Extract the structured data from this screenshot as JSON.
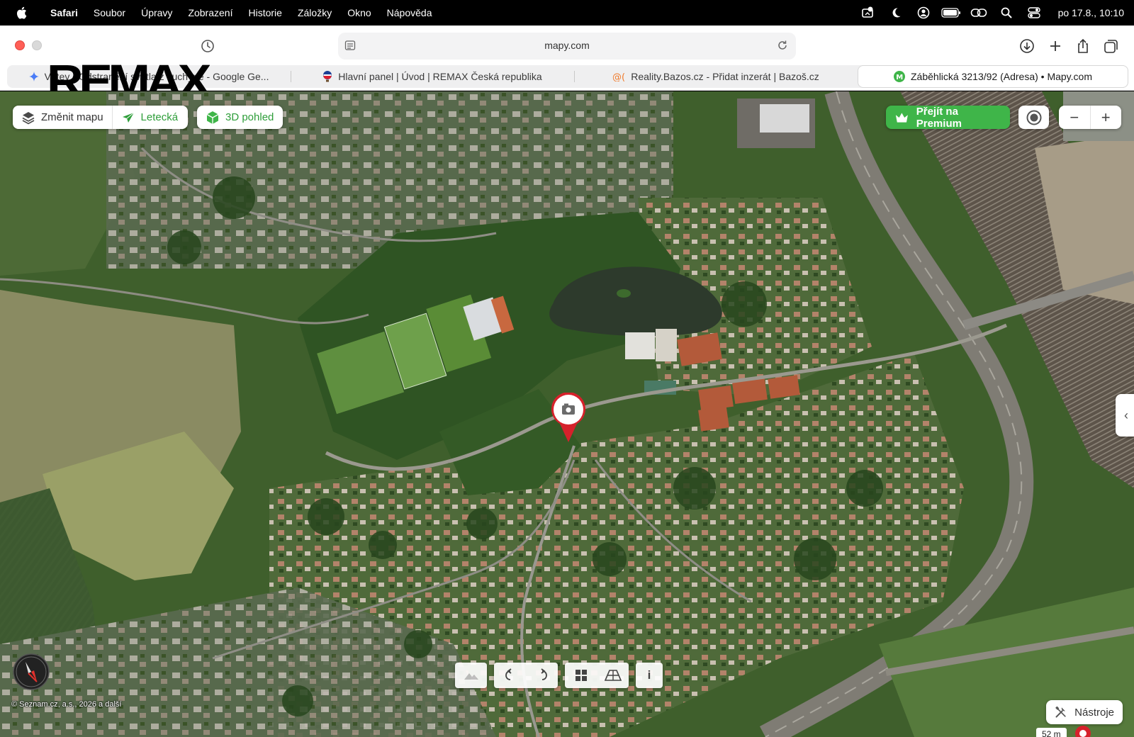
{
  "menubar": {
    "app": "Safari",
    "items": [
      "Soubor",
      "Úpravy",
      "Zobrazení",
      "Historie",
      "Záložky",
      "Okno",
      "Nápověda"
    ],
    "clock": "po 17.8., 10:10",
    "status_icons": [
      "screen-share-icon",
      "focus-moon-icon",
      "user-account-icon",
      "battery-icon",
      "linked-devices-icon",
      "spotlight-search-icon",
      "control-center-icon"
    ]
  },
  "browser": {
    "url": "mapy.com",
    "logo_overlay": "REMAX",
    "tabs": [
      {
        "label": "Větev • Odstranění světla z kuchyně - Google Ge...",
        "icon": "gemini-sparkle-icon",
        "active": false
      },
      {
        "label": "Hlavní panel | Úvod | REMAX Česká republika",
        "icon": "remax-balloon-icon",
        "active": false
      },
      {
        "label": "Reality.Bazos.cz - Přidat inzerát | Bazoš.cz",
        "icon": "bazos-icon",
        "active": false
      },
      {
        "label": "Záběhlická 3213/92 (Adresa) • Mapy.com",
        "icon": "mapy-m-icon",
        "active": true
      }
    ]
  },
  "map": {
    "change_map": "Změnit mapu",
    "aerial": "Letecká",
    "view_3d": "3D pohled",
    "premium": "Přejít na Premium",
    "zoom_out": "−",
    "zoom_in": "+",
    "copyright": "© Seznam.cz, a.s., 2026 a další",
    "tools": "Nástroje",
    "scale": "52 m",
    "info": "i",
    "accent_green": "#3fb549",
    "pin_red": "#d6212b"
  }
}
